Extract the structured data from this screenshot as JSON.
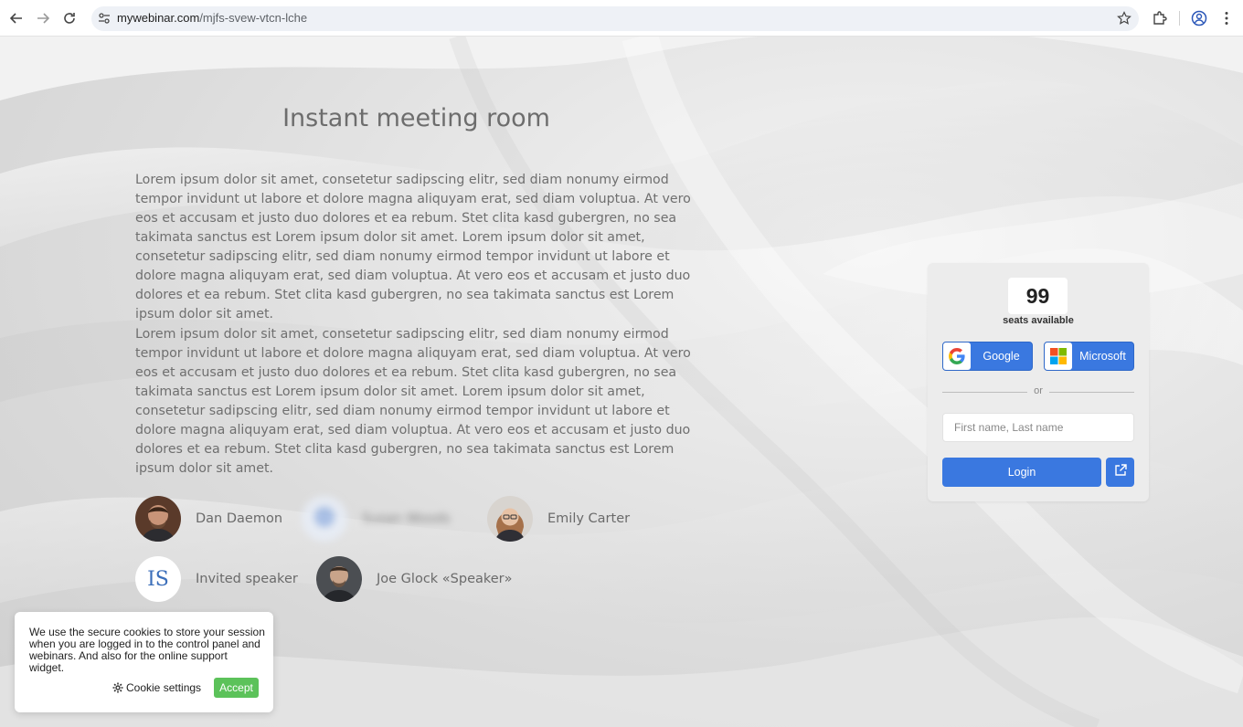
{
  "browser": {
    "url_host": "mywebinar.com",
    "url_path": "/mjfs-svew-vtcn-lche"
  },
  "page": {
    "title": "Instant meeting room",
    "paragraphs": [
      "Lorem ipsum dolor sit amet, consetetur sadipscing elitr, sed diam nonumy eirmod tempor invidunt ut labore et dolore magna aliquyam erat, sed diam voluptua. At vero eos et accusam et justo duo dolores et ea rebum. Stet clita kasd gubergren, no sea takimata sanctus est Lorem ipsum dolor sit amet. Lorem ipsum dolor sit amet, consetetur sadipscing elitr, sed diam nonumy eirmod tempor invidunt ut labore et dolore magna aliquyam erat, sed diam voluptua. At vero eos et accusam et justo duo dolores et ea rebum. Stet clita kasd gubergren, no sea takimata sanctus est Lorem ipsum dolor sit amet.",
      "Lorem ipsum dolor sit amet, consetetur sadipscing elitr, sed diam nonumy eirmod tempor invidunt ut labore et dolore magna aliquyam erat, sed diam voluptua. At vero eos et accusam et justo duo dolores et ea rebum. Stet clita kasd gubergren, no sea takimata sanctus est Lorem ipsum dolor sit amet. Lorem ipsum dolor sit amet, consetetur sadipscing elitr, sed diam nonumy eirmod tempor invidunt ut labore et dolore magna aliquyam erat, sed diam voluptua. At vero eos et accusam et justo duo dolores et ea rebum. Stet clita kasd gubergren, no sea takimata sanctus est Lorem ipsum dolor sit amet."
    ],
    "speakers": [
      {
        "name": "Dan Daemon"
      },
      {
        "name": "Susan Woods"
      },
      {
        "name": "Emily Carter"
      },
      {
        "name": "Invited speaker",
        "initials": "IS"
      },
      {
        "name": "Joe Glock «Speaker»"
      }
    ]
  },
  "login": {
    "seats_count": "99",
    "seats_label": "seats available",
    "google_label": "Google",
    "microsoft_label": "Microsoft",
    "or_label": "or",
    "name_placeholder": "First name, Last name",
    "login_label": "Login"
  },
  "cookie": {
    "text": "We use the secure cookies to store your session when you are logged in to the control panel and webinars. And also for the online support widget.",
    "settings_label": "Cookie settings",
    "accept_label": "Accept"
  },
  "colors": {
    "primary": "#3a78e0",
    "accept": "#5cc25a",
    "initials": "#3c6fba"
  }
}
